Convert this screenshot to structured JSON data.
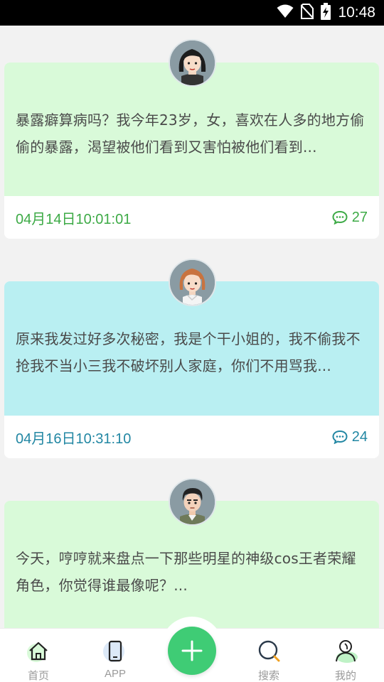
{
  "status_bar": {
    "time": "10:48"
  },
  "posts": [
    {
      "text": "暴露癖算病吗？我今年23岁，女，喜欢在人多的地方偷偷的暴露，渴望被他们看到又害怕被他们看到...",
      "date": "04月14日10:01:01",
      "comments": "27",
      "bg": "#d9fad9",
      "accent": "#3daa46"
    },
    {
      "text": "原来我发过好多次秘密，我是个干小姐的，我不偷我不抢我不当小三我不破坏别人家庭，你们不用骂我...",
      "date": "04月16日10:31:10",
      "comments": "24",
      "bg": "#b9eff2",
      "accent": "#2287a3"
    },
    {
      "text": "今天，哼哼就来盘点一下那些明星的神级cos王者荣耀角色，你觉得谁最像呢？...",
      "bg": "#d9fad9",
      "accent": "#3daa46"
    }
  ],
  "nav": {
    "home": "首页",
    "app": "APP",
    "search": "搜索",
    "mine": "我的"
  },
  "colors": {
    "fab": "#3fcc75",
    "nav_label": "#9a9a9a"
  }
}
